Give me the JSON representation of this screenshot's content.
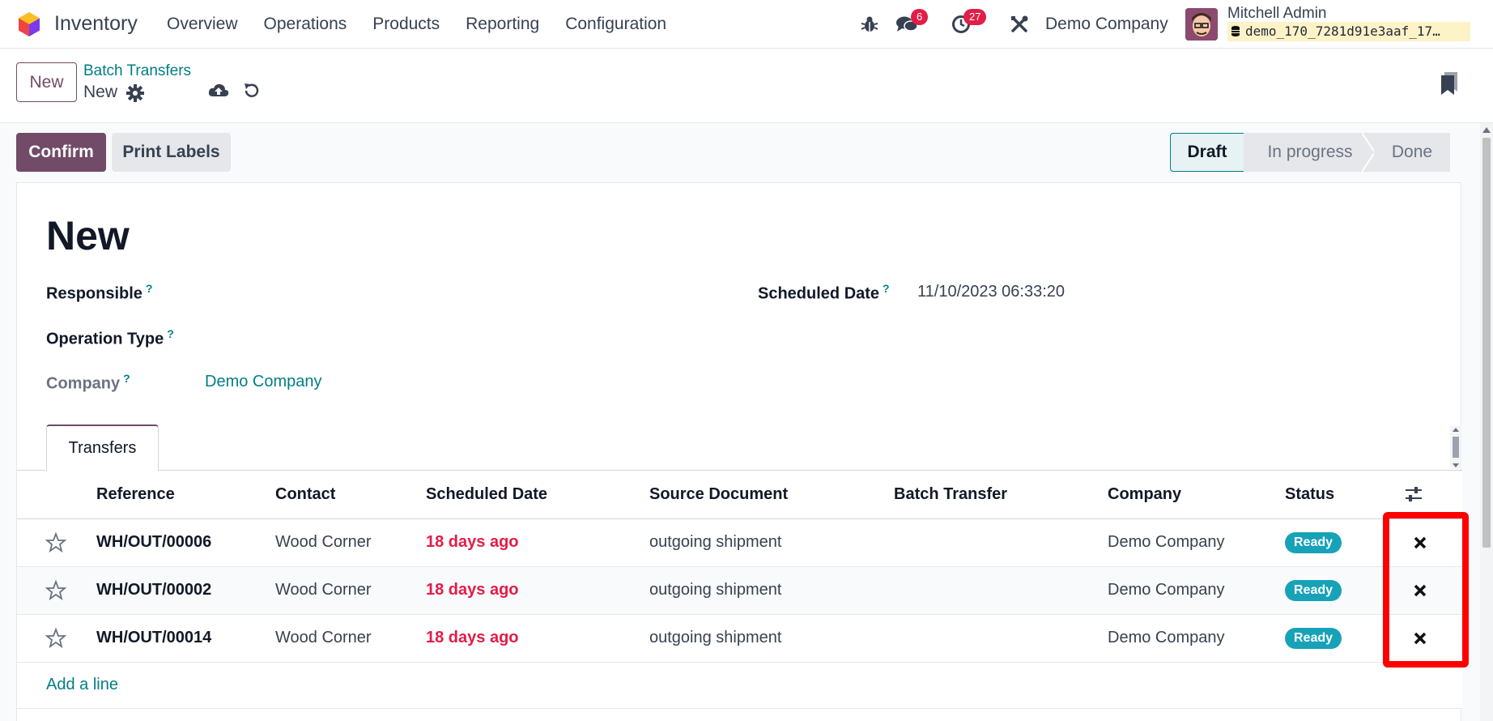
{
  "navbar": {
    "app_name": "Inventory",
    "menu": [
      "Overview",
      "Operations",
      "Products",
      "Reporting",
      "Configuration"
    ],
    "messages_count": "6",
    "activities_count": "27",
    "company": "Demo Company",
    "user_name": "Mitchell Admin",
    "database": "demo_170_7281d91e3aaf_17…"
  },
  "control": {
    "new_label": "New",
    "breadcrumb_parent": "Batch Transfers",
    "breadcrumb_current": "New"
  },
  "actions": {
    "confirm_label": "Confirm",
    "print_labels_label": "Print Labels"
  },
  "status_stages": [
    "Draft",
    "In progress",
    "Done"
  ],
  "active_stage": "Draft",
  "form": {
    "title": "New",
    "responsible_label": "Responsible",
    "operation_type_label": "Operation Type",
    "company_label": "Company",
    "company_value": "Demo Company",
    "scheduled_date_label": "Scheduled Date",
    "scheduled_date_value": "11/10/2023 06:33:20",
    "help_mark": "?"
  },
  "tabs": [
    "Transfers"
  ],
  "table": {
    "columns": [
      "Reference",
      "Contact",
      "Scheduled Date",
      "Source Document",
      "Batch Transfer",
      "Company",
      "Status"
    ],
    "rows": [
      {
        "reference": "WH/OUT/00006",
        "contact": "Wood Corner",
        "scheduled": "18 days ago",
        "source": "outgoing shipment",
        "batch": "",
        "company": "Demo Company",
        "status": "Ready"
      },
      {
        "reference": "WH/OUT/00002",
        "contact": "Wood Corner",
        "scheduled": "18 days ago",
        "source": "outgoing shipment",
        "batch": "",
        "company": "Demo Company",
        "status": "Ready"
      },
      {
        "reference": "WH/OUT/00014",
        "contact": "Wood Corner",
        "scheduled": "18 days ago",
        "source": "outgoing shipment",
        "batch": "",
        "company": "Demo Company",
        "status": "Ready"
      }
    ],
    "add_line_label": "Add a line"
  },
  "colors": {
    "brand": "#714b67",
    "link": "#017e84",
    "late": "#e11d48",
    "ready_badge": "#17a2b8",
    "highlight": "#ff0000"
  },
  "icons": [
    "bug-icon",
    "chat-icon",
    "clock-icon",
    "tools-icon",
    "gear-icon",
    "cloud-upload-icon",
    "discard-icon",
    "bookmark-icon",
    "star-icon",
    "remove-icon",
    "optional-columns-icon"
  ]
}
